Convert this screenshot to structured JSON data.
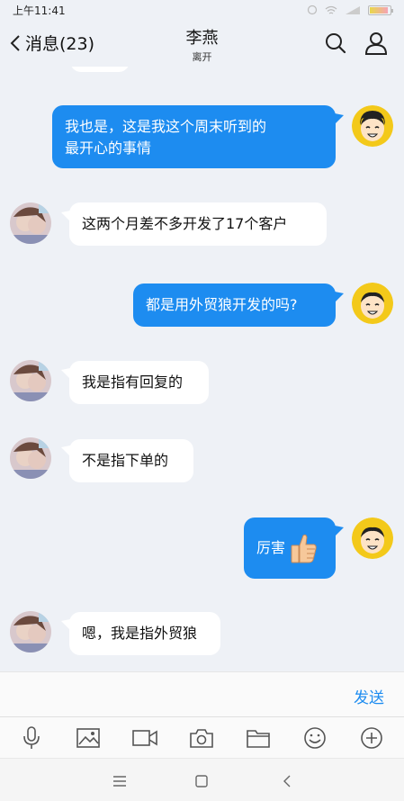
{
  "status": {
    "time": "上午11:41"
  },
  "header": {
    "back_label": "消息(23)",
    "title": "李燕",
    "subtitle": "离开"
  },
  "messages": [
    {
      "side": "out",
      "lines": [
        "我也是，这是我这个周末听到的",
        "最开心的事情"
      ]
    },
    {
      "side": "in",
      "lines": [
        "这两个月差不多开发了17个客户"
      ]
    },
    {
      "side": "out",
      "lines": [
        "都是用外贸狼开发的吗?"
      ]
    },
    {
      "side": "in",
      "lines": [
        "我是指有回复的"
      ]
    },
    {
      "side": "in",
      "lines": [
        "不是指下单的"
      ]
    },
    {
      "side": "out",
      "lines": [
        "厉害"
      ],
      "emoji": "thumbs-up"
    },
    {
      "side": "in",
      "lines": [
        "嗯，我是指外贸狼"
      ]
    }
  ],
  "input": {
    "send_label": "发送"
  },
  "toolbar": [
    "mic-icon",
    "image-icon",
    "video-icon",
    "camera-icon",
    "folder-icon",
    "emoji-icon",
    "plus-icon"
  ],
  "colors": {
    "accent": "#1d8cf0",
    "background": "#eef1f6"
  }
}
